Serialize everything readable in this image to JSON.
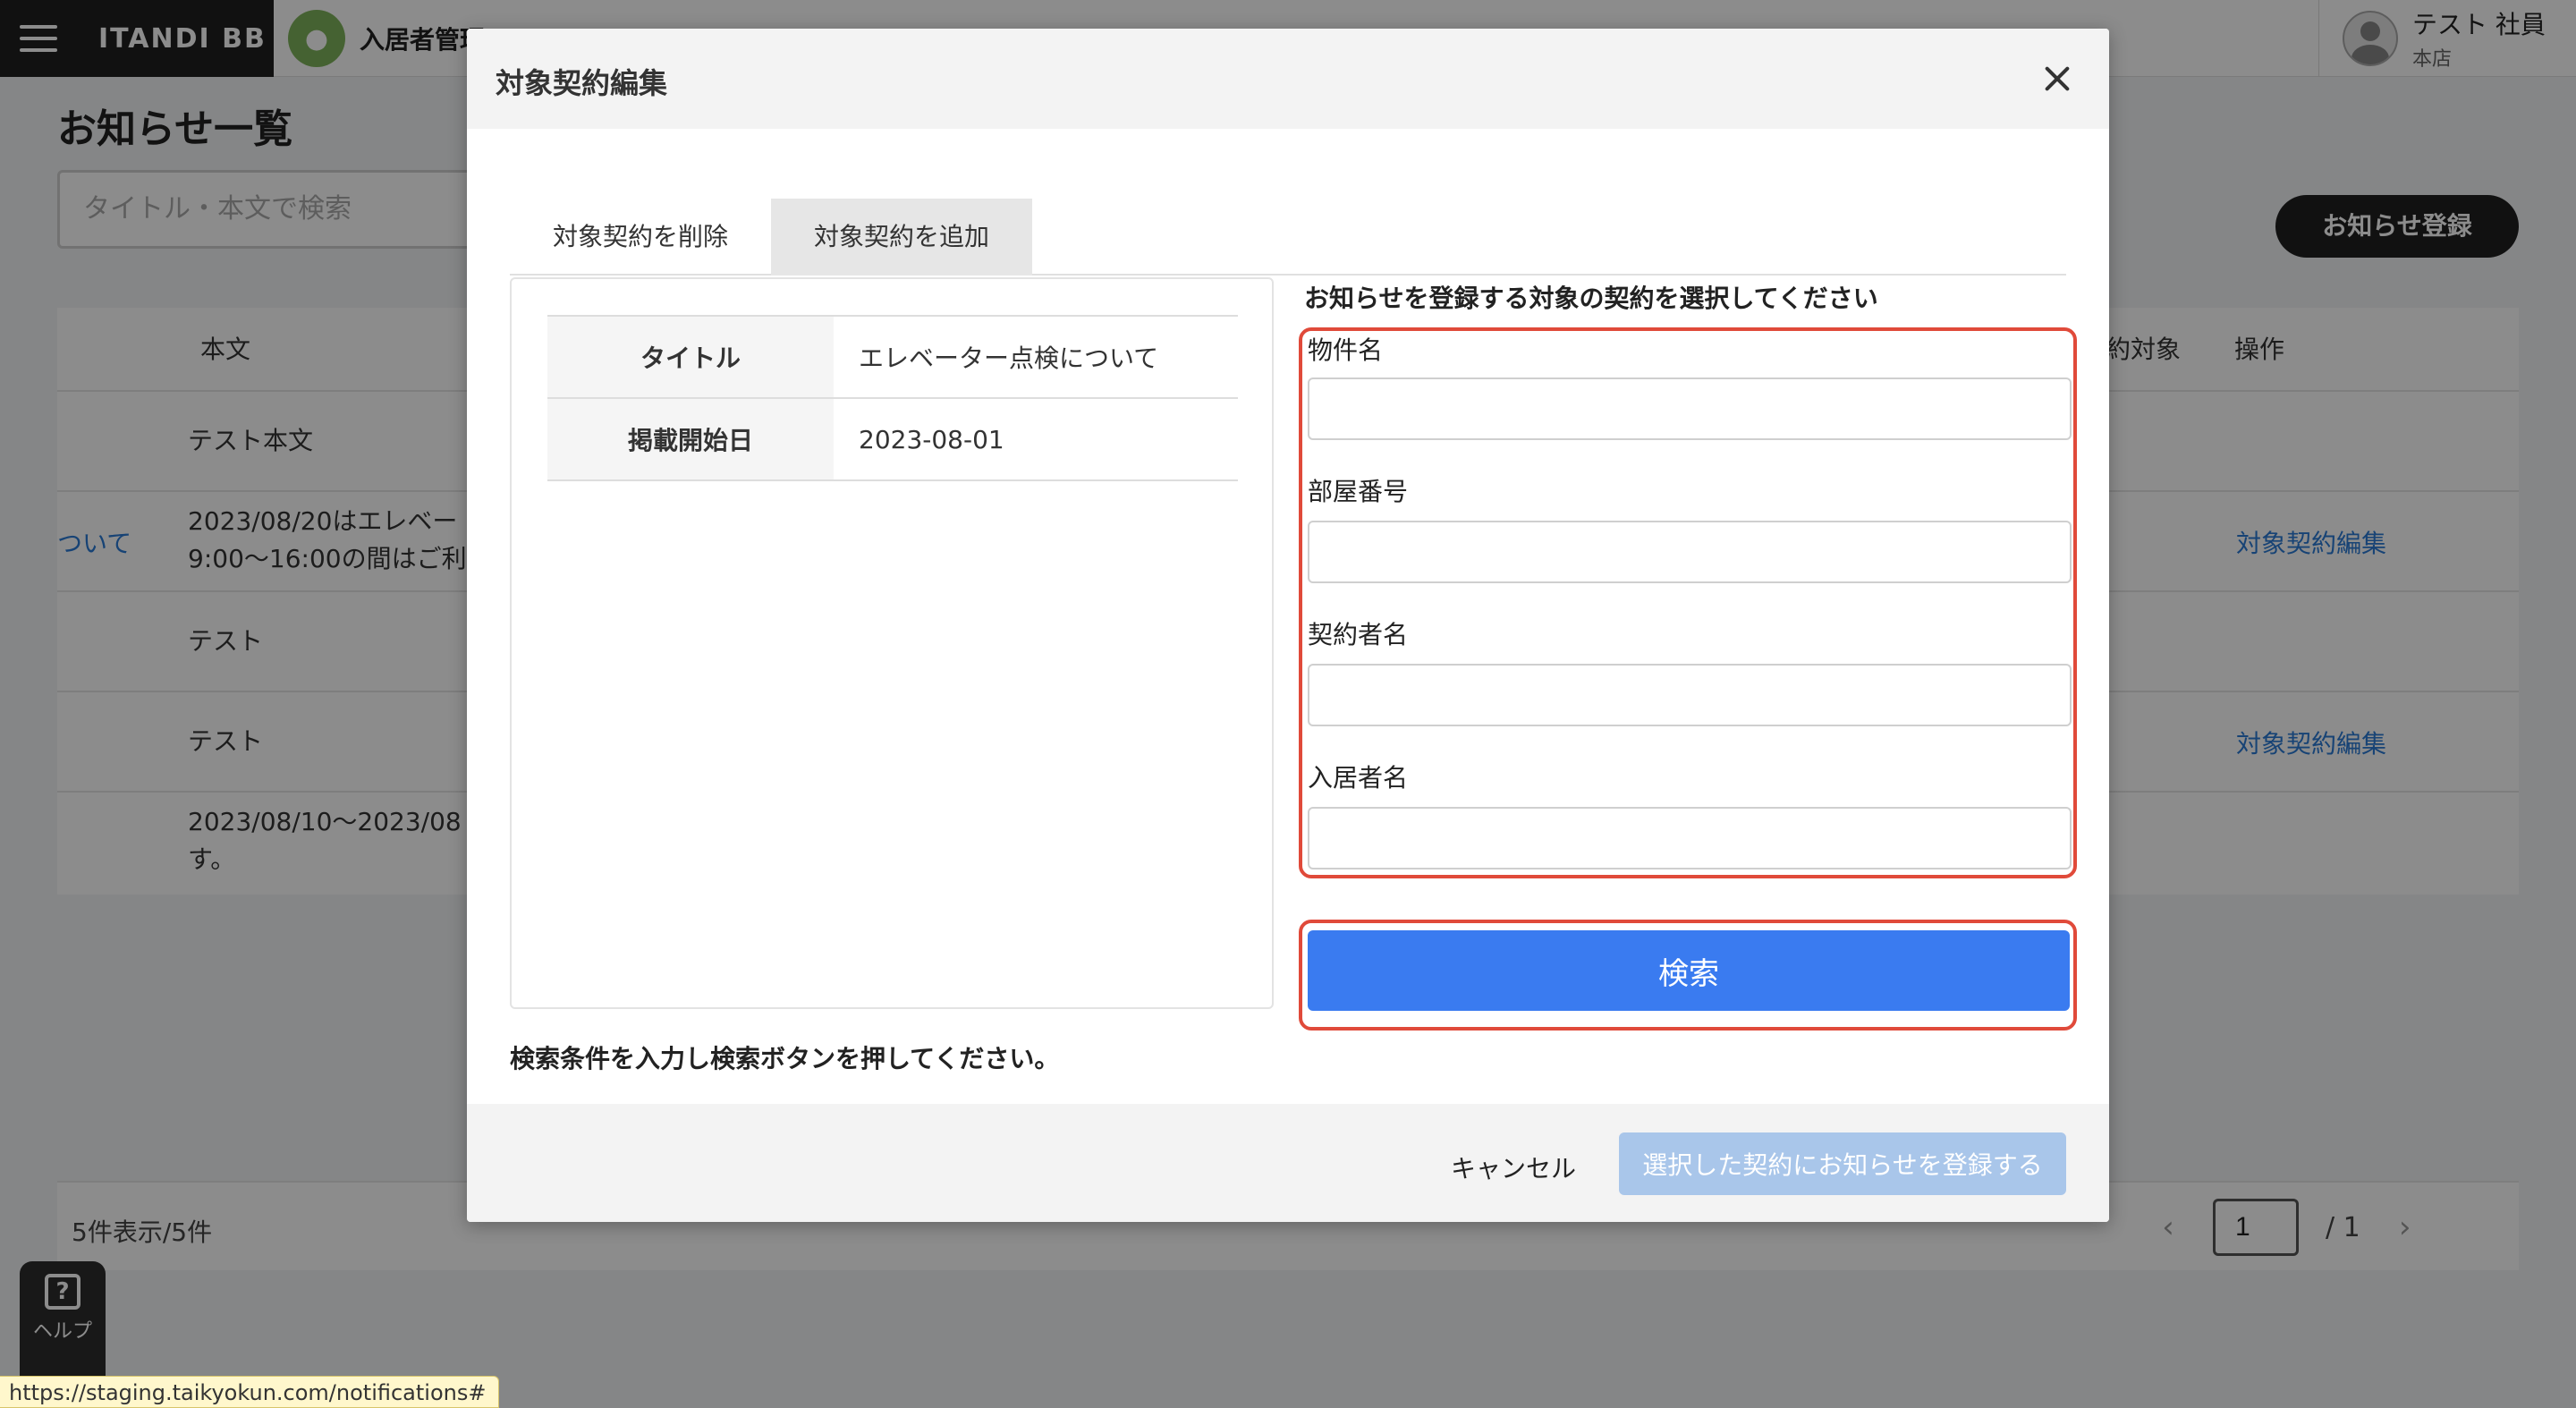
{
  "topbar": {
    "brand": "ITANDI BB",
    "app_name": "入居者管理",
    "user_name": "テスト 社員",
    "user_branch": "本店"
  },
  "background": {
    "page_title": "お知らせ一覧",
    "search_placeholder": "タイトル・本文で検索",
    "register_button": "お知らせ登録",
    "columns": {
      "body": "本文",
      "target": "約対象",
      "actions": "操作"
    },
    "rows": [
      {
        "title": "",
        "body": "テスト本文",
        "action": ""
      },
      {
        "title": "ついて",
        "body": "2023/08/20はエレベー\n9:00〜16:00の間はご利",
        "action": "対象契約編集"
      },
      {
        "title": "",
        "body": "テスト",
        "action": ""
      },
      {
        "title": "",
        "body": "テスト",
        "action": "対象契約編集"
      },
      {
        "title": "",
        "body": "2023/08/10〜2023/08\nす。",
        "action": ""
      }
    ],
    "count_text": "5件表示/5件",
    "page_current": "1",
    "page_total": "/ 1",
    "help_label": "ヘルプ"
  },
  "status_url": "https://staging.taikyokun.com/notifications#",
  "modal": {
    "title": "対象契約編集",
    "tabs": [
      {
        "label": "対象契約を削除",
        "active": false
      },
      {
        "label": "対象契約を追加",
        "active": true
      }
    ],
    "info": [
      {
        "key": "タイトル",
        "value": "エレベーター点検について"
      },
      {
        "key": "掲載開始日",
        "value": "2023-08-01"
      }
    ],
    "instruction": "お知らせを登録する対象の契約を選択してください",
    "fields": [
      {
        "label": "物件名",
        "value": ""
      },
      {
        "label": "部屋番号",
        "value": ""
      },
      {
        "label": "契約者名",
        "value": ""
      },
      {
        "label": "入居者名",
        "value": ""
      }
    ],
    "search_button": "検索",
    "search_hint": "検索条件を入力し検索ボタンを押してください。",
    "cancel_button": "キャンセル",
    "submit_button": "選択した契約にお知らせを登録する"
  },
  "colors": {
    "primary": "#3a7bf0",
    "highlight": "#e04a3a",
    "disabled": "#a9c6ea",
    "link": "#2b7bd6"
  }
}
